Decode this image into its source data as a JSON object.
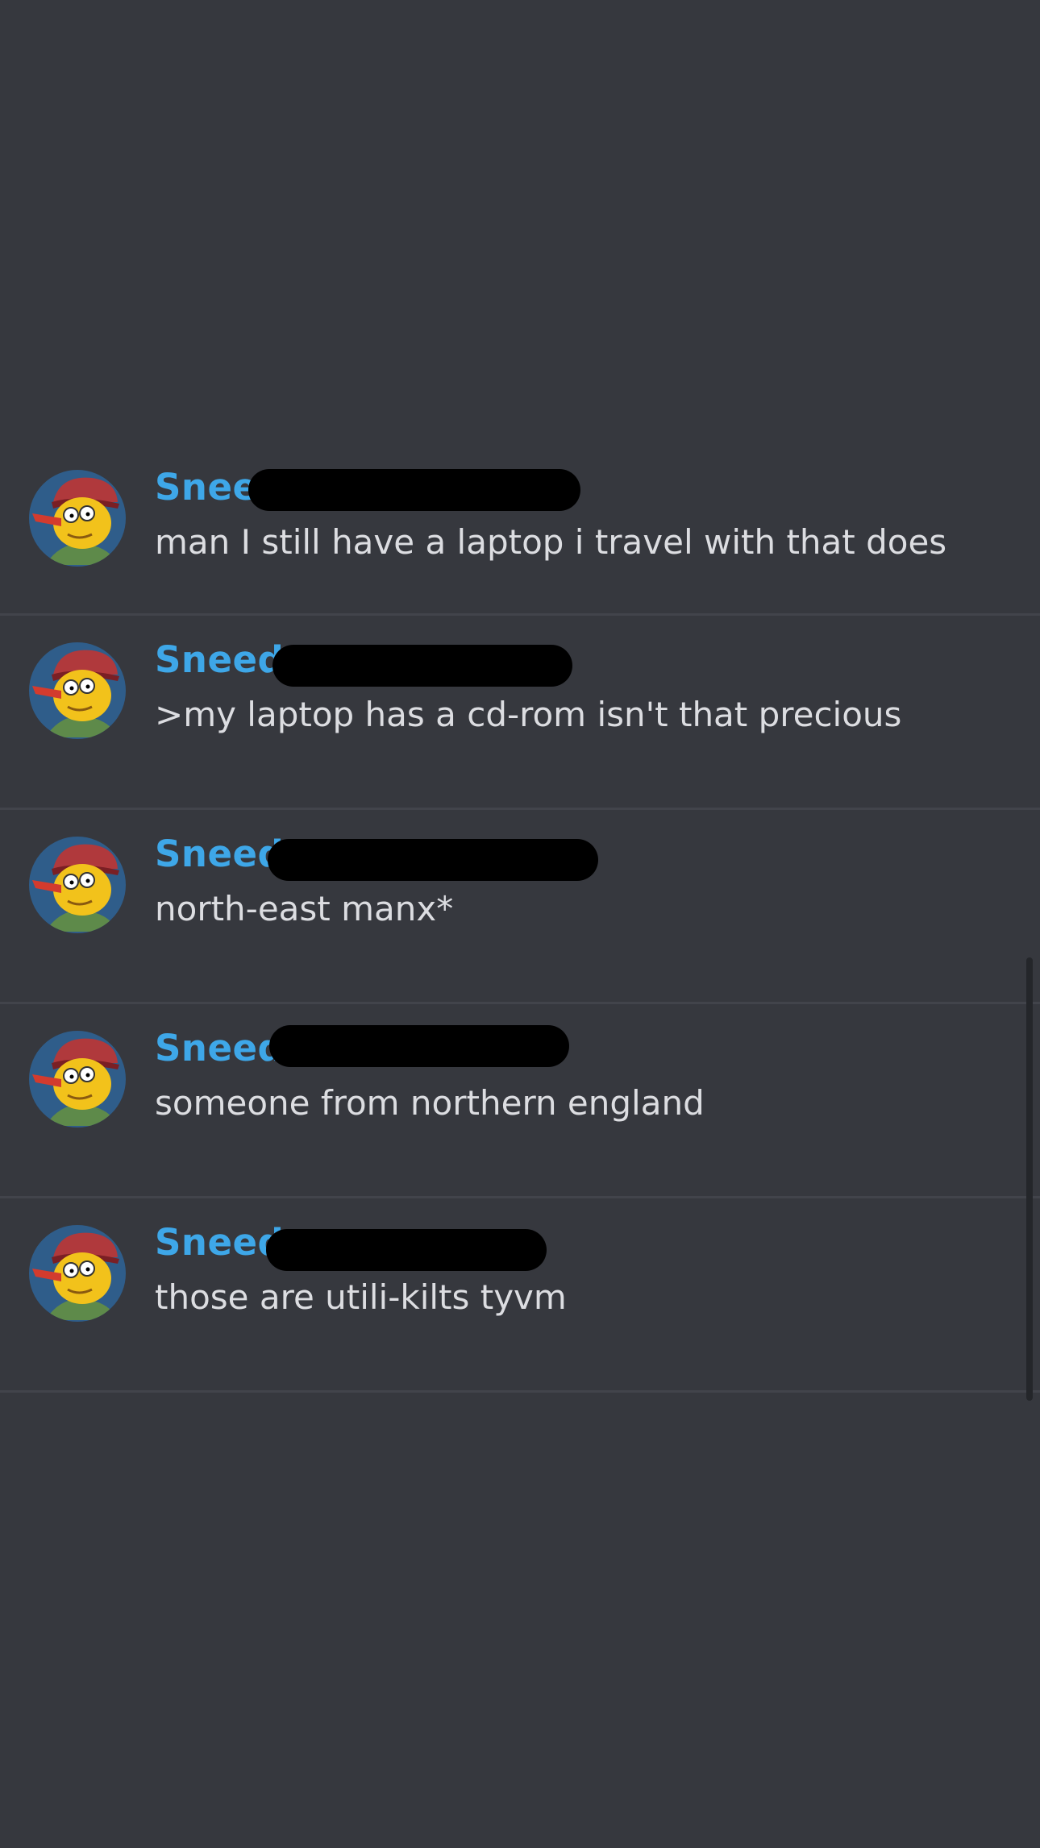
{
  "messages": [
    {
      "author": "Sneed",
      "content": "man I still have a laptop i travel with that does"
    },
    {
      "author": "Sneed",
      "content": ">my laptop has a cd-rom isn't that precious"
    },
    {
      "author": "Sneed",
      "content": "north-east manx*"
    },
    {
      "author": "Sneed",
      "content": "someone from northern england"
    },
    {
      "author": "Sneed",
      "content": "those are utili-kilts tyvm"
    }
  ],
  "colors": {
    "background": "#36383e",
    "author": "#3ea7e8",
    "text": "#dcdde1",
    "divider": "#42444b"
  }
}
